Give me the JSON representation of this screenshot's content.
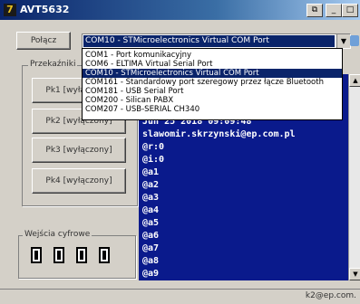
{
  "window": {
    "title": "AVT5632",
    "icon": "app-logo-icon"
  },
  "toolbar": {
    "connect_label": "Połącz",
    "port_selected": "COM10 - STMicroelectronics Virtual COM Port"
  },
  "port_dropdown": {
    "options": [
      "COM1 - Port komunikacyjny",
      "COM6 - ELTIMA Virtual Serial Port",
      "COM10 - STMicroelectronics Virtual COM Port",
      "COM161 - Standardowy port szeregowy przez łącze Bluetooth",
      "COM181 - USB Serial Port",
      "COM200 - Silican PABX",
      "COM207 - USB-SERIAL CH340"
    ],
    "selected_index": 2
  },
  "relays": {
    "title": "Przekaźniki",
    "buttons": [
      "Pk1 [wyłączony]",
      "Pk2 [wyłączony]",
      "Pk3 [wyłączony]",
      "Pk4 [wyłączony]"
    ]
  },
  "digital_inputs": {
    "title": "Wejścia cyfrowe",
    "count": 4
  },
  "terminal": {
    "lines": [
      "Jun 25 2018 09:09:48",
      "slawomir.skrzynski@ep.com.pl",
      "@r:0",
      "@i:0",
      "@a1",
      "@a2",
      "@a3",
      "@a4",
      "@a5",
      "@a6",
      "@a7",
      "@a8",
      "@a9"
    ]
  },
  "statusbar": {
    "text": "k2@ep.com."
  },
  "colors": {
    "terminal_bg": "#0a1a8c",
    "selection": "#0a246a"
  }
}
